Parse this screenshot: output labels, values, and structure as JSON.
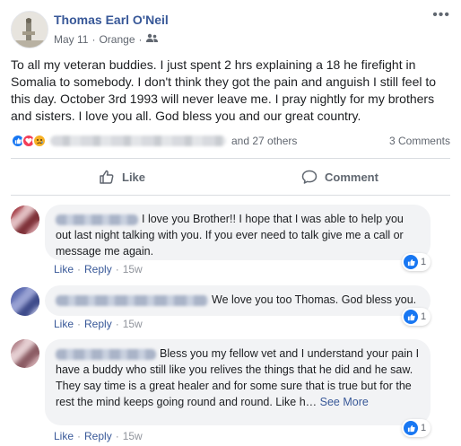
{
  "post": {
    "author": "Thomas Earl O'Neil",
    "date": "May 11",
    "location": "Orange",
    "separator": "·",
    "more_menu": "•••",
    "text": "To all my veteran buddies. I just spent 2 hrs explaining a 18 he firefight in Somalia to somebody. I don't think they got the pain and anguish I still feel to this day. October 3rd 1993 will never leave me. I pray nightly for my brothers and sisters. I love you all. God bless you and our great country.",
    "audience_icon": "friends-icon"
  },
  "reactions": {
    "icons": [
      "like-reaction-icon",
      "love-reaction-icon",
      "sad-reaction-icon"
    ],
    "others": "and 27 others",
    "comments_count": "3 Comments"
  },
  "actions": {
    "like": "Like",
    "comment": "Comment"
  },
  "comments": [
    {
      "text": "I love you Brother!! I hope that I was able to help you out last night talking with you. If you ever need to talk give me a call or message me again.",
      "like": "Like",
      "reply": "Reply",
      "time": "15w",
      "reaction_count": "1"
    },
    {
      "text": "We love you too Thomas. God bless you.",
      "like": "Like",
      "reply": "Reply",
      "time": "15w",
      "reaction_count": "1"
    },
    {
      "text": "Bless you my fellow vet and I understand your pain I have a buddy who still like you relives the things that he did and he saw. They say time is a great healer and for some sure that is true but for the rest the mind keeps going round and round. Like h…",
      "see_more": "See More",
      "like": "Like",
      "reply": "Reply",
      "time": "15w",
      "reaction_count": "1"
    }
  ],
  "colors": {
    "link_blue": "#385898",
    "like_blue": "#1877f2",
    "love_red": "#f33e58",
    "sad_yellow": "#f7b125",
    "bubble_gray": "#f2f3f5"
  }
}
